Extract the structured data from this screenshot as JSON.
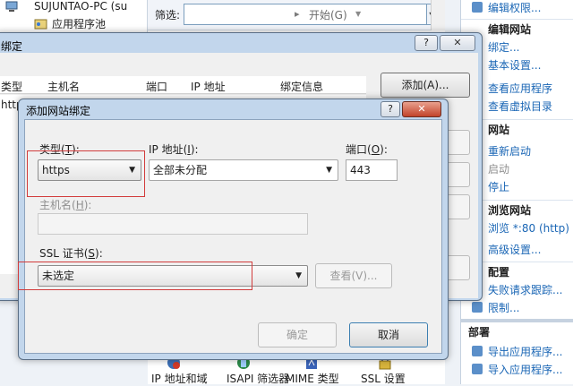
{
  "tree": {
    "computer": "SUJUNTAO-PC (su",
    "app_pools": "应用程序池"
  },
  "toolbar": {
    "filter_label": "筛选:",
    "filter_value": "",
    "start_label": "开始(G)"
  },
  "actions": {
    "items": [
      {
        "text": "编辑权限...",
        "type": "link"
      },
      {
        "text": "编辑网站",
        "type": "header"
      },
      {
        "text": "绑定...",
        "type": "link"
      },
      {
        "text": "基本设置...",
        "type": "link"
      },
      {
        "text": "查看应用程序",
        "type": "link"
      },
      {
        "text": "查看虚拟目录",
        "type": "link"
      },
      {
        "text": "网站",
        "type": "header"
      },
      {
        "text": "重新启动",
        "type": "link"
      },
      {
        "text": "启动",
        "type": "disabled"
      },
      {
        "text": "停止",
        "type": "link"
      },
      {
        "text": "浏览网站",
        "type": "header"
      },
      {
        "text": "浏览 *:80 (http)",
        "type": "link"
      },
      {
        "text": "高级设置...",
        "type": "link"
      },
      {
        "text": "配置",
        "type": "header"
      },
      {
        "text": "失败请求跟踪...",
        "type": "link"
      },
      {
        "text": "限制...",
        "type": "link"
      },
      {
        "text": "部署",
        "type": "section"
      },
      {
        "text": "导出应用程序...",
        "type": "link"
      },
      {
        "text": "导入应用程序...",
        "type": "link"
      }
    ]
  },
  "bottom_icons": [
    "IP 地址和域",
    "ISAPI 筛选器",
    "MIME 类型",
    "SSL 设置"
  ],
  "bindings_dialog": {
    "title": "绑定",
    "help": "?",
    "close": "✕",
    "columns": [
      "类型",
      "主机名",
      "端口",
      "IP 地址",
      "绑定信息"
    ],
    "row_type": "http",
    "add_button": "添加(A)..."
  },
  "add_dialog": {
    "title": "添加网站绑定",
    "help": "?",
    "close": "✕",
    "type_label": "类型(T):",
    "type_value": "https",
    "ip_label": "IP 地址(I):",
    "ip_value": "全部未分配",
    "port_label": "端口(O):",
    "port_value": "443",
    "host_label": "主机名(H):",
    "host_value": "",
    "ssl_label": "SSL 证书(S):",
    "ssl_value": "未选定",
    "view_button": "查看(V)...",
    "ok_button": "确定",
    "cancel_button": "取消"
  },
  "colors": {
    "link": "#1a66b5",
    "highlight_box": "#d23c3c",
    "window_frame": "#c2d6ec"
  }
}
